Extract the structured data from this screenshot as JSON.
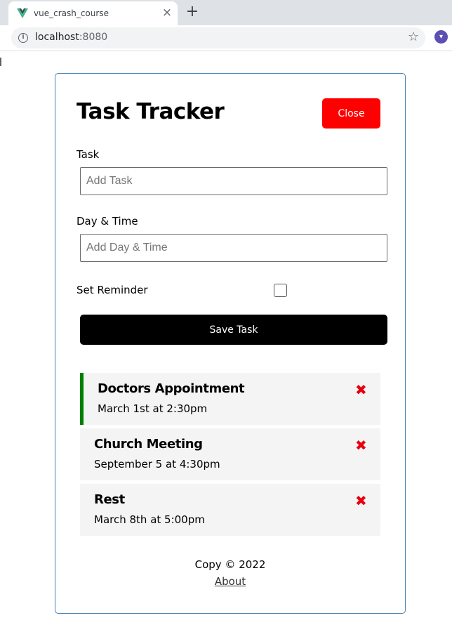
{
  "browser": {
    "tab_title": "vue_crash_course",
    "tab_close": "×",
    "new_tab": "+",
    "url_host": "localhost",
    "url_port": ":8080"
  },
  "header": {
    "title": "Task Tracker",
    "close_label": "Close"
  },
  "form": {
    "task_label": "Task",
    "task_placeholder": "Add Task",
    "task_value": "",
    "day_label": "Day & Time",
    "day_placeholder": "Add Day & Time",
    "day_value": "",
    "reminder_label": "Set Reminder",
    "reminder_checked": false,
    "save_label": "Save Task"
  },
  "tasks": [
    {
      "text": "Doctors Appointment",
      "day": "March 1st at 2:30pm",
      "reminder": true
    },
    {
      "text": "Church Meeting",
      "day": "September 5 at 4:30pm",
      "reminder": false
    },
    {
      "text": "Rest",
      "day": "March 8th at 5:00pm",
      "reminder": false
    }
  ],
  "footer": {
    "copyright": "Copy © 2022",
    "about_label": "About"
  },
  "colors": {
    "close_button": "#ff0000",
    "reminder_border": "#008000",
    "delete_icon": "#e8000f",
    "container_border": "#4682b4"
  }
}
